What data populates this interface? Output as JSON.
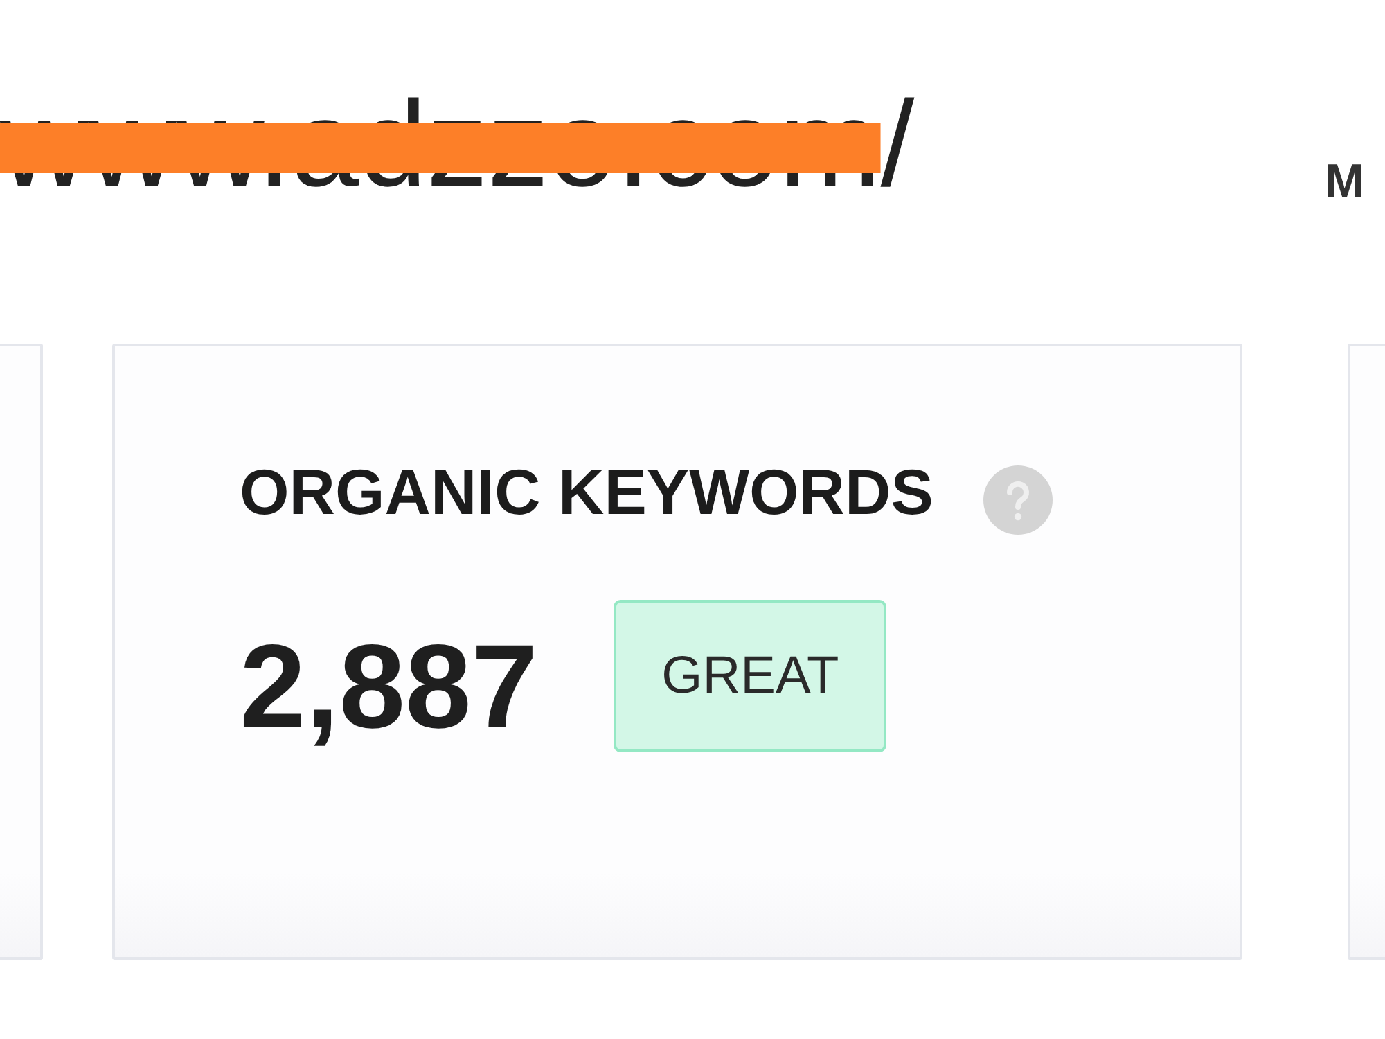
{
  "header": {
    "url": {
      "text": "www.adzzo.com/",
      "redacted": true
    },
    "side_label": "M"
  },
  "cards": [
    {
      "kind": "edge"
    },
    {
      "kind": "metric",
      "title": "ORGANIC KEYWORDS",
      "value": "2,887",
      "badge": "GREAT"
    },
    {
      "kind": "edge"
    }
  ]
}
